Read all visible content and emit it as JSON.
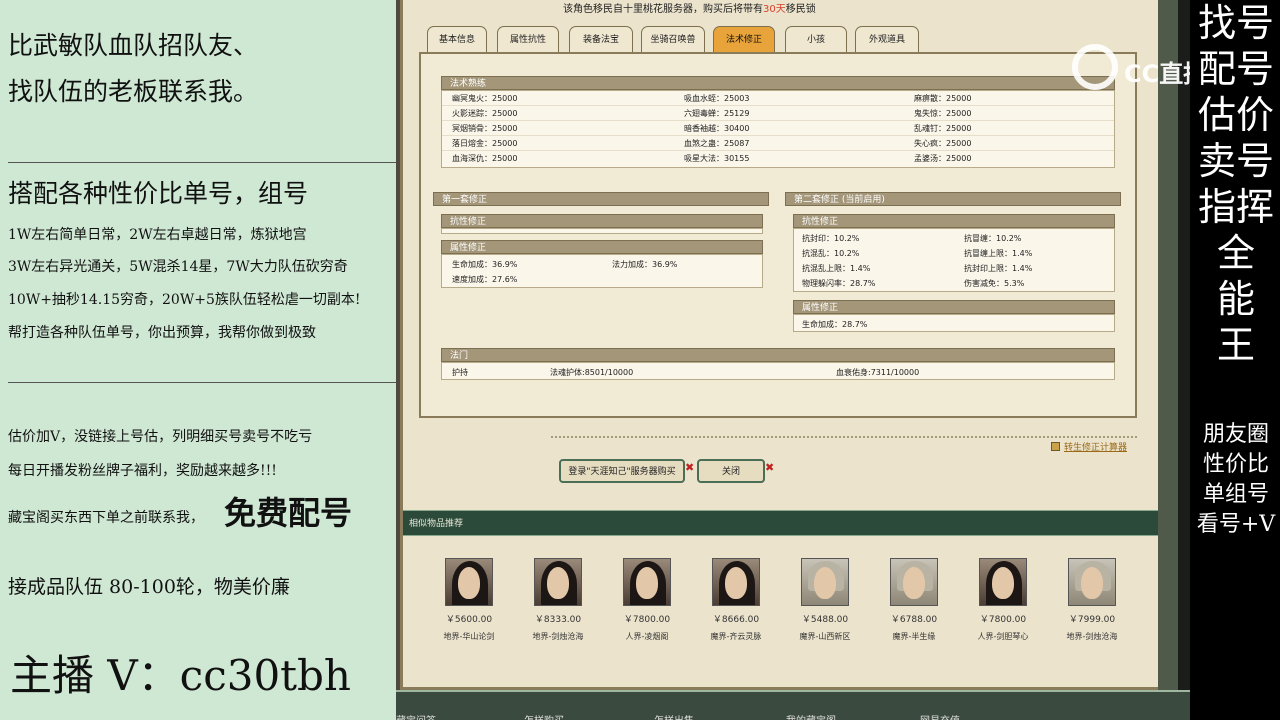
{
  "left_panel": {
    "line1": "比武敏队血队招队友、",
    "line2": "找队伍的老板联系我。",
    "line3": "搭配各种性价比单号，组号",
    "line4": "1W左右简单日常，2W左右卓越日常，炼狱地宫",
    "line5": "3W左右异光通关，5W混杀14星，7W大力队伍砍穷奇",
    "line6": "10W+抽秒14.15穷奇，20W+5族队伍轻松虐一切副本!",
    "line7": "帮打造各种队伍单号，你出预算，我帮你做到极致",
    "line8": "估价加V，没链接上号估，列明细买号卖号不吃亏",
    "line9": "每日开播发粉丝牌子福利，奖励越来越多!!!",
    "line10": "藏宝阁买东西下单之前联系我，",
    "big": "免费配号",
    "line11": "接成品队伍 80-100轮，物美价廉",
    "anchor": "主播 V：cc30tbh"
  },
  "right_panel": {
    "big_chars": [
      "找号",
      "配号",
      "估价",
      "卖号",
      "指挥",
      "全",
      "能",
      "王"
    ],
    "small_lines": [
      "朋友圈",
      "性价比",
      "单组号",
      "看号+V"
    ]
  },
  "watermark": {
    "text": "CC直播"
  },
  "game": {
    "notice_pre": "该角色移民自十里桃花服务器，购买后将带有",
    "notice_days": "30天",
    "notice_post": "移民锁",
    "tabs": [
      {
        "label": "基本信息"
      },
      {
        "label": "属性抗性"
      },
      {
        "label": "装备法宝"
      },
      {
        "label": "坐骑召唤兽"
      },
      {
        "label": "法术修正"
      },
      {
        "label": "小孩"
      },
      {
        "label": "外观道具"
      }
    ],
    "active_tab": "法术修正",
    "skills": {
      "title": "法术熟练",
      "rows": [
        [
          "幽冥鬼火：25000",
          "吸血水蛭：25003",
          "麻痹散：25000"
        ],
        [
          "火影迷踪：25000",
          "六翅毒蝉：25129",
          "鬼失惊：25000"
        ],
        [
          "冥烟销骨：25000",
          "暗香袖越：30400",
          "乱魂钉：25000"
        ],
        [
          "落日熔金：25000",
          "血煞之蛊：25087",
          "失心疯：25000"
        ],
        [
          "血海深仇：25000",
          "吸星大法：30155",
          "孟婆汤：25000"
        ]
      ]
    },
    "set1": {
      "title": "第一套修正",
      "resist_title": "抗性修正",
      "attr_title": "属性修正",
      "attr_rows": [
        [
          "生命加成：36.9%",
          "法力加成：36.9%"
        ],
        [
          "速度加成：27.6%",
          ""
        ]
      ]
    },
    "set2": {
      "title": "第二套修正 (当前启用)",
      "resist_title": "抗性修正",
      "resist_rows": [
        [
          "抗封印：10.2%",
          "抗冒缠：10.2%"
        ],
        [
          "抗混乱：10.2%",
          "抗冒缠上限：1.4%"
        ],
        [
          "抗混乱上限：1.4%",
          "抗封印上限：1.4%"
        ],
        [
          "物理躲闪率：28.7%",
          "伤害减免：5.3%"
        ]
      ],
      "attr_title": "属性修正",
      "attr_row": "生命加成：28.7%"
    },
    "magic": {
      "title": "法门",
      "label": "护持",
      "v1": "法魂护体:8501/10000",
      "v2": "血衰佑身:7311/10000"
    },
    "calc_link": "转生修正计算器",
    "login_btn": "登录\"天涯知己\"服务器购买",
    "close_btn": "关闭",
    "rec_title": "相似物品推荐",
    "recommendations": [
      {
        "price": "￥5600.00",
        "server": "地界-华山论剑"
      },
      {
        "price": "￥8333.00",
        "server": "地界-剑烛沧海"
      },
      {
        "price": "￥7800.00",
        "server": "人界-凌烟阁"
      },
      {
        "price": "￥8666.00",
        "server": "魔界-齐云灵脉"
      },
      {
        "price": "￥5488.00",
        "server": "魔界-山西新区"
      },
      {
        "price": "￥6788.00",
        "server": "魔界-半生缘"
      },
      {
        "price": "￥7800.00",
        "server": "人界-剑胆琴心"
      },
      {
        "price": "￥7999.00",
        "server": "地界-剑烛沧海"
      }
    ],
    "bottom_nav": [
      "藏宝问答",
      "怎样购买",
      "怎样出售",
      "我的藏宝阁",
      "网易充值"
    ]
  }
}
